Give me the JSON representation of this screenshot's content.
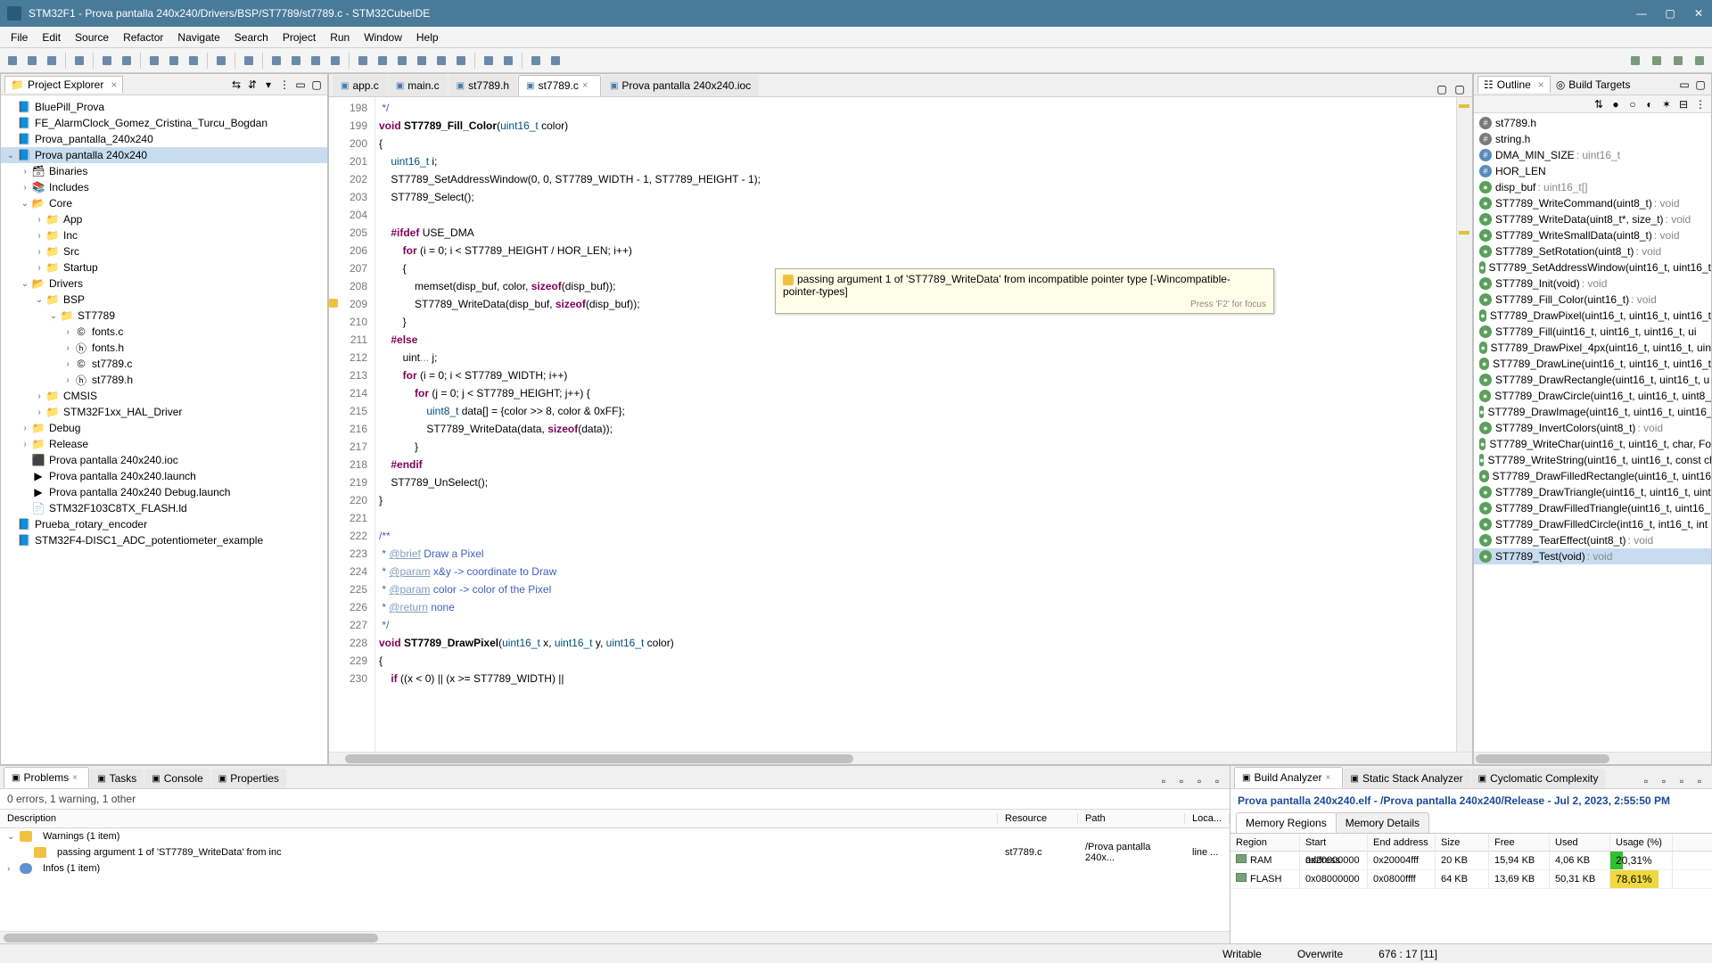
{
  "window": {
    "title": "STM32F1 - Prova pantalla 240x240/Drivers/BSP/ST7789/st7789.c - STM32CubeIDE"
  },
  "menubar": [
    "File",
    "Edit",
    "Source",
    "Refactor",
    "Navigate",
    "Search",
    "Project",
    "Run",
    "Window",
    "Help"
  ],
  "project_explorer": {
    "title": "Project Explorer",
    "items": [
      {
        "depth": 0,
        "toggle": "",
        "icon": "proj",
        "label": "BluePill_Prova"
      },
      {
        "depth": 0,
        "toggle": "",
        "icon": "proj",
        "label": "FE_AlarmClock_Gomez_Cristina_Turcu_Bogdan"
      },
      {
        "depth": 0,
        "toggle": "",
        "icon": "proj",
        "label": "Prova_pantalla_240x240"
      },
      {
        "depth": 0,
        "toggle": "v",
        "icon": "proj",
        "label": "Prova pantalla 240x240",
        "selected": true
      },
      {
        "depth": 1,
        "toggle": ">",
        "icon": "bin",
        "label": "Binaries"
      },
      {
        "depth": 1,
        "toggle": ">",
        "icon": "inc",
        "label": "Includes"
      },
      {
        "depth": 1,
        "toggle": "v",
        "icon": "src",
        "label": "Core"
      },
      {
        "depth": 2,
        "toggle": ">",
        "icon": "fld",
        "label": "App"
      },
      {
        "depth": 2,
        "toggle": ">",
        "icon": "fld",
        "label": "Inc"
      },
      {
        "depth": 2,
        "toggle": ">",
        "icon": "fld",
        "label": "Src"
      },
      {
        "depth": 2,
        "toggle": ">",
        "icon": "fld",
        "label": "Startup"
      },
      {
        "depth": 1,
        "toggle": "v",
        "icon": "src",
        "label": "Drivers"
      },
      {
        "depth": 2,
        "toggle": "v",
        "icon": "fld",
        "label": "BSP"
      },
      {
        "depth": 3,
        "toggle": "v",
        "icon": "fld",
        "label": "ST7789"
      },
      {
        "depth": 4,
        "toggle": ">",
        "icon": "c",
        "label": "fonts.c"
      },
      {
        "depth": 4,
        "toggle": ">",
        "icon": "h",
        "label": "fonts.h"
      },
      {
        "depth": 4,
        "toggle": ">",
        "icon": "c",
        "label": "st7789.c"
      },
      {
        "depth": 4,
        "toggle": ">",
        "icon": "h",
        "label": "st7789.h"
      },
      {
        "depth": 2,
        "toggle": ">",
        "icon": "fld",
        "label": "CMSIS"
      },
      {
        "depth": 2,
        "toggle": ">",
        "icon": "fld",
        "label": "STM32F1xx_HAL_Driver"
      },
      {
        "depth": 1,
        "toggle": ">",
        "icon": "fld",
        "label": "Debug"
      },
      {
        "depth": 1,
        "toggle": ">",
        "icon": "fld",
        "label": "Release"
      },
      {
        "depth": 1,
        "toggle": "",
        "icon": "ioc",
        "label": "Prova pantalla 240x240.ioc"
      },
      {
        "depth": 1,
        "toggle": "",
        "icon": "lnch",
        "label": "Prova pantalla 240x240.launch"
      },
      {
        "depth": 1,
        "toggle": "",
        "icon": "lnch",
        "label": "Prova pantalla 240x240 Debug.launch"
      },
      {
        "depth": 1,
        "toggle": "",
        "icon": "ld",
        "label": "STM32F103C8TX_FLASH.ld"
      },
      {
        "depth": 0,
        "toggle": "",
        "icon": "proj",
        "label": "Prueba_rotary_encoder"
      },
      {
        "depth": 0,
        "toggle": "",
        "icon": "proj",
        "label": "STM32F4-DISC1_ADC_potentiometer_example"
      }
    ]
  },
  "editor": {
    "tabs": [
      {
        "icon": "c",
        "label": "app.c"
      },
      {
        "icon": "c",
        "label": "main.c"
      },
      {
        "icon": "h",
        "label": "st7789.h"
      },
      {
        "icon": "c",
        "label": "st7789.c",
        "active": true,
        "close": true
      },
      {
        "icon": "ioc",
        "label": "Prova pantalla 240x240.ioc"
      }
    ],
    "first_line": 198,
    "warn_at": 209,
    "lines": [
      {
        "html": "<span class='doc'> */</span>"
      },
      {
        "html": "<span class='kw'>void</span> <span class='fn'>ST7789_Fill_Color</span>(<span class='ty'>uint16_t</span> color)"
      },
      {
        "html": "{"
      },
      {
        "html": "    <span class='ty'>uint16_t</span> i;"
      },
      {
        "html": "    ST7789_SetAddressWindow(0, 0, ST7789_WIDTH - 1, ST7789_HEIGHT - 1);"
      },
      {
        "html": "    ST7789_Select();"
      },
      {
        "html": ""
      },
      {
        "html": "    <span class='pp'>#ifdef</span> USE_DMA"
      },
      {
        "html": "        <span class='kw'>for</span> (i = 0; i &lt; ST7789_HEIGHT / HOR_LEN; i++)"
      },
      {
        "html": "        {"
      },
      {
        "html": "            memset(disp_buf, color, <span class='kw'>sizeof</span>(disp_buf));"
      },
      {
        "html": "            ST7789_WriteData(disp_buf, <span class='kw'>sizeof</span>(disp_buf));"
      },
      {
        "html": "        }"
      },
      {
        "html": "    <span class='pp'>#else</span>"
      },
      {
        "html": "        uint<span style='color:#888'>...</span> j;"
      },
      {
        "html": "        <span class='kw'>for</span> (i = 0; i &lt; ST7789_WIDTH; i++)"
      },
      {
        "html": "            <span class='kw'>for</span> (j = 0; j &lt; ST7789_HEIGHT; j++) {"
      },
      {
        "html": "                <span class='ty'>uint8_t</span> data[] = {color &gt;&gt; 8, color &amp; 0xFF};"
      },
      {
        "html": "                ST7789_WriteData(data, <span class='kw'>sizeof</span>(data));"
      },
      {
        "html": "            }"
      },
      {
        "html": "    <span class='pp'>#endif</span>"
      },
      {
        "html": "    ST7789_UnSelect();"
      },
      {
        "html": "}"
      },
      {
        "html": ""
      },
      {
        "html": "<span class='doc'>/**</span>"
      },
      {
        "html": "<span class='doc'> * <span class='tag2'>@brief</span> Draw a Pixel</span>"
      },
      {
        "html": "<span class='doc'> * <span class='tag2'>@param</span> x&y -&gt; coordinate to Draw</span>"
      },
      {
        "html": "<span class='doc'> * <span class='tag2'>@param</span> color -&gt; color of the Pixel</span>"
      },
      {
        "html": "<span class='doc'> * <span class='tag2'>@return</span> none</span>"
      },
      {
        "html": "<span class='doc'> */</span>"
      },
      {
        "html": "<span class='kw'>void</span> <span class='fn'>ST7789_DrawPixel</span>(<span class='ty'>uint16_t</span> x, <span class='ty'>uint16_t</span> y, <span class='ty'>uint16_t</span> color)"
      },
      {
        "html": "{"
      },
      {
        "html": "    <span class='kw'>if</span> ((x &lt; 0) || (x &gt;= ST7789_WIDTH) ||"
      }
    ],
    "tooltip": {
      "text": "passing argument 1 of 'ST7789_WriteData' from incompatible pointer type [-Wincompatible-pointer-types]",
      "hint": "Press 'F2' for focus"
    }
  },
  "outline": {
    "title": "Outline",
    "build_targets": "Build Targets",
    "items": [
      {
        "k": "inc",
        "name": "st7789.h"
      },
      {
        "k": "inc",
        "name": "string.h"
      },
      {
        "k": "def",
        "name": "DMA_MIN_SIZE",
        "sig": ": uint16_t"
      },
      {
        "k": "def",
        "name": "HOR_LEN"
      },
      {
        "k": "var",
        "name": "disp_buf",
        "sig": ": uint16_t[]"
      },
      {
        "k": "fun",
        "name": "ST7789_WriteCommand(uint8_t)",
        "sig": ": void"
      },
      {
        "k": "fun",
        "name": "ST7789_WriteData(uint8_t*, size_t)",
        "sig": ": void"
      },
      {
        "k": "fun",
        "name": "ST7789_WriteSmallData(uint8_t)",
        "sig": ": void"
      },
      {
        "k": "fun",
        "name": "ST7789_SetRotation(uint8_t)",
        "sig": ": void"
      },
      {
        "k": "fun",
        "name": "ST7789_SetAddressWindow(uint16_t, uint16_t"
      },
      {
        "k": "fun",
        "name": "ST7789_Init(void)",
        "sig": ": void"
      },
      {
        "k": "fun",
        "name": "ST7789_Fill_Color(uint16_t)",
        "sig": ": void"
      },
      {
        "k": "fun",
        "name": "ST7789_DrawPixel(uint16_t, uint16_t, uint16_t"
      },
      {
        "k": "fun",
        "name": "ST7789_Fill(uint16_t, uint16_t, uint16_t, ui"
      },
      {
        "k": "fun",
        "name": "ST7789_DrawPixel_4px(uint16_t, uint16_t, uin"
      },
      {
        "k": "fun",
        "name": "ST7789_DrawLine(uint16_t, uint16_t, uint16_t"
      },
      {
        "k": "fun",
        "name": "ST7789_DrawRectangle(uint16_t, uint16_t, u"
      },
      {
        "k": "fun",
        "name": "ST7789_DrawCircle(uint16_t, uint16_t, uint8_"
      },
      {
        "k": "fun",
        "name": "ST7789_DrawImage(uint16_t, uint16_t, uint16_"
      },
      {
        "k": "fun",
        "name": "ST7789_InvertColors(uint8_t)",
        "sig": ": void"
      },
      {
        "k": "fun",
        "name": "ST7789_WriteChar(uint16_t, uint16_t, char, Fo"
      },
      {
        "k": "fun",
        "name": "ST7789_WriteString(uint16_t, uint16_t, const ch"
      },
      {
        "k": "fun",
        "name": "ST7789_DrawFilledRectangle(uint16_t, uint16"
      },
      {
        "k": "fun",
        "name": "ST7789_DrawTriangle(uint16_t, uint16_t, uint"
      },
      {
        "k": "fun",
        "name": "ST7789_DrawFilledTriangle(uint16_t, uint16_"
      },
      {
        "k": "fun",
        "name": "ST7789_DrawFilledCircle(int16_t, int16_t, int"
      },
      {
        "k": "fun",
        "name": "ST7789_TearEffect(uint8_t)",
        "sig": ": void"
      },
      {
        "k": "fun",
        "name": "ST7789_Test(void)",
        "sig": ": void",
        "selected": true
      }
    ]
  },
  "problems": {
    "tabs": [
      {
        "label": "Problems",
        "active": true,
        "close": true
      },
      {
        "label": "Tasks"
      },
      {
        "label": "Console"
      },
      {
        "label": "Properties"
      }
    ],
    "summary": "0 errors, 1 warning, 1 other",
    "columns": {
      "desc": "Description",
      "res": "Resource",
      "path": "Path",
      "loc": "Loca..."
    },
    "rows": [
      {
        "depth": 0,
        "toggle": "v",
        "icon": "warn",
        "desc": "Warnings (1 item)"
      },
      {
        "depth": 1,
        "toggle": "",
        "icon": "warn",
        "desc": "passing argument 1 of 'ST7789_WriteData' from inc",
        "res": "st7789.c",
        "path": "/Prova pantalla 240x...",
        "loc": "line ..."
      },
      {
        "depth": 0,
        "toggle": ">",
        "icon": "info",
        "desc": "Infos (1 item)"
      }
    ]
  },
  "build_analyzer": {
    "tabs": [
      {
        "label": "Build Analyzer",
        "active": true
      },
      {
        "label": "Static Stack Analyzer"
      },
      {
        "label": "Cyclomatic Complexity"
      }
    ],
    "title": "Prova pantalla 240x240.elf - /Prova pantalla 240x240/Release - Jul 2, 2023, 2:55:50 PM",
    "subtabs": [
      {
        "label": "Memory Regions",
        "active": true
      },
      {
        "label": "Memory Details"
      }
    ],
    "columns": [
      "Region",
      "Start address",
      "End address",
      "Size",
      "Free",
      "Used",
      "Usage (%)"
    ],
    "rows": [
      {
        "region": "RAM",
        "sa": "0x20000000",
        "ea": "0x20004fff",
        "sz": "20 KB",
        "fr": "15,94 KB",
        "us": "4,06 KB",
        "up_txt": "20,31%",
        "up": 20.31,
        "color": "#30c030"
      },
      {
        "region": "FLASH",
        "sa": "0x08000000",
        "ea": "0x0800ffff",
        "sz": "64 KB",
        "fr": "13,69 KB",
        "us": "50,31 KB",
        "up_txt": "78,61%",
        "up": 78.61,
        "color": "#f0d840"
      }
    ]
  },
  "statusbar": {
    "writable": "Writable",
    "overwrite": "Overwrite",
    "pos": "676 : 17 [11]"
  }
}
